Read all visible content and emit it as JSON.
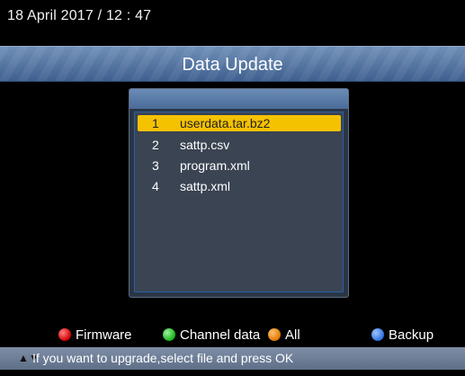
{
  "header": {
    "datetime": "18 April 2017 / 12 : 47"
  },
  "title": "Data Update",
  "files": [
    {
      "num": "1",
      "name": "userdata.tar.bz2",
      "selected": true
    },
    {
      "num": "2",
      "name": "sattp.csv",
      "selected": false
    },
    {
      "num": "3",
      "name": "program.xml",
      "selected": false
    },
    {
      "num": "4",
      "name": "sattp.xml",
      "selected": false
    }
  ],
  "legend": {
    "red": {
      "label": "Firmware",
      "color": "#d00000",
      "icon": "red-button-icon"
    },
    "green": {
      "label": "Channel data",
      "color": "#18b318",
      "icon": "green-button-icon"
    },
    "orange": {
      "label": "All",
      "color": "#e07800",
      "icon": "orange-button-icon"
    },
    "blue": {
      "label": "Backup",
      "color": "#2f6fe0",
      "icon": "blue-button-icon"
    }
  },
  "help": {
    "icon": "up-down-arrows-icon",
    "text": "If you want to upgrade,select file and press OK"
  }
}
